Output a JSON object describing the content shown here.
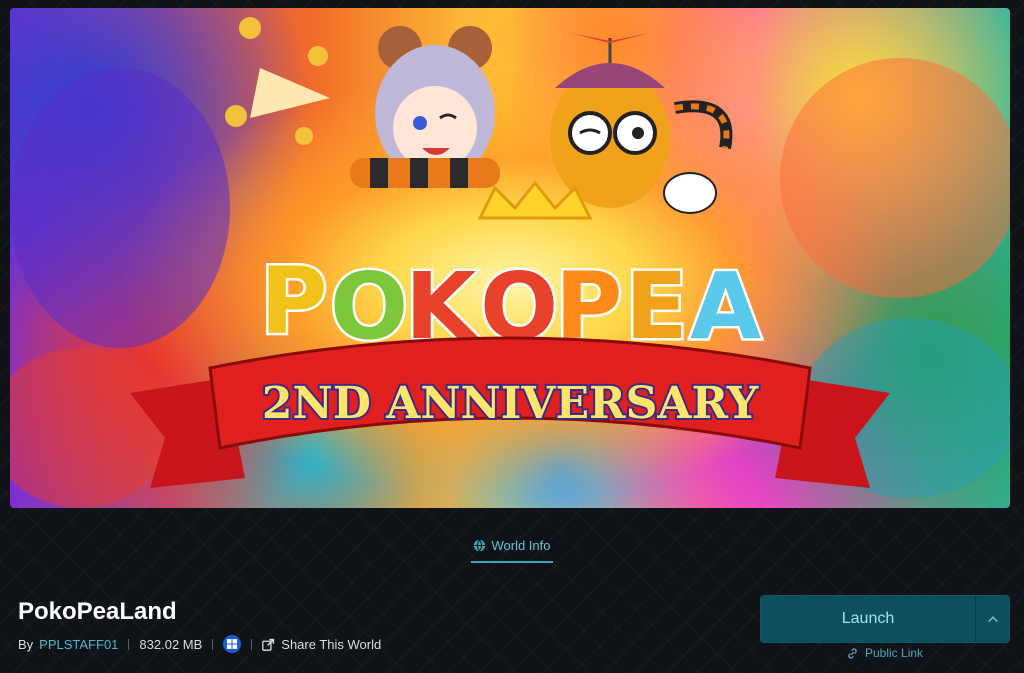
{
  "banner": {
    "logo_text": "POKOPEA",
    "ribbon_text": "2ND ANNIVERSARY"
  },
  "tabs": [
    {
      "label": "World Info",
      "icon": "globe-icon",
      "active": true
    }
  ],
  "world": {
    "title": "PokoPeaLand",
    "by_label": "By",
    "author": "PPLSTAFF01",
    "size": "832.02 MB",
    "platform_icon": "windows-icon",
    "share_label": "Share This World"
  },
  "actions": {
    "launch_label": "Launch",
    "public_link_label": "Public Link"
  },
  "colors": {
    "accent": "#4fb6cc",
    "launch_bg": "#0d4f5c",
    "background": "#0f1317"
  }
}
